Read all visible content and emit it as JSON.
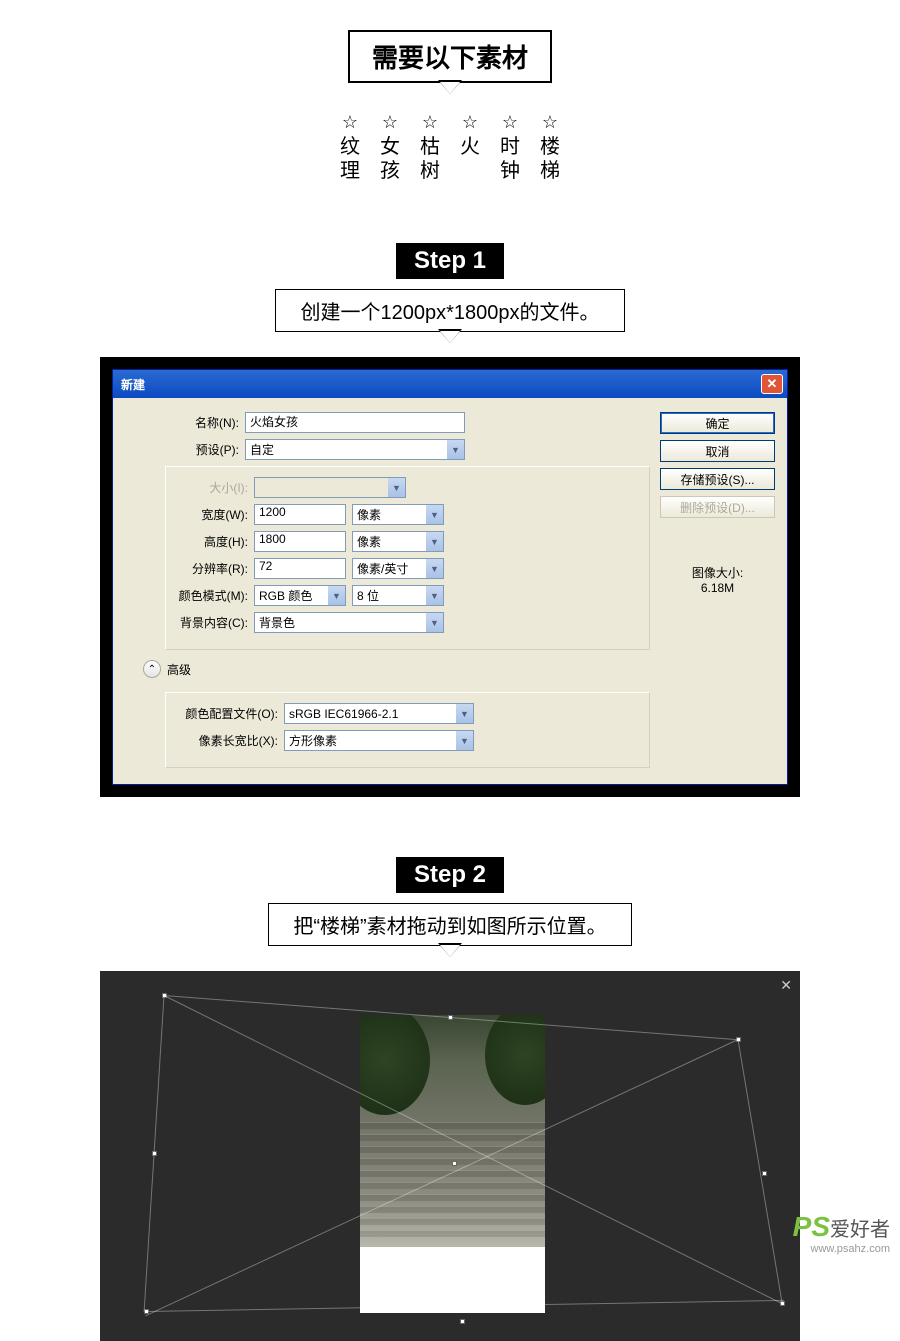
{
  "header": {
    "title": "需要以下素材"
  },
  "materials": [
    {
      "label": "纹理"
    },
    {
      "label": "女孩"
    },
    {
      "label": "枯树"
    },
    {
      "label": "火"
    },
    {
      "label": "时钟"
    },
    {
      "label": "楼梯"
    }
  ],
  "step1": {
    "tag": "Step 1",
    "desc": "创建一个1200px*1800px的文件。",
    "dialog": {
      "title": "新建",
      "name_label": "名称(N):",
      "name_value": "火焰女孩",
      "preset_label": "预设(P):",
      "preset_value": "自定",
      "size_label": "大小(I):",
      "width_label": "宽度(W):",
      "width_value": "1200",
      "width_unit": "像素",
      "height_label": "高度(H):",
      "height_value": "1800",
      "height_unit": "像素",
      "res_label": "分辨率(R):",
      "res_value": "72",
      "res_unit": "像素/英寸",
      "mode_label": "颜色模式(M):",
      "mode_value": "RGB 颜色",
      "mode_bit": "8 位",
      "bg_label": "背景内容(C):",
      "bg_value": "背景色",
      "adv_label": "高级",
      "profile_label": "颜色配置文件(O):",
      "profile_value": "sRGB IEC61966-2.1",
      "aspect_label": "像素长宽比(X):",
      "aspect_value": "方形像素",
      "ok": "确定",
      "cancel": "取消",
      "save_preset": "存储预设(S)...",
      "del_preset": "删除预设(D)...",
      "info_label": "图像大小:",
      "info_value": "6.18M"
    }
  },
  "step2": {
    "tag": "Step 2",
    "desc": "把“楼梯”素材拖动到如图所示位置。"
  },
  "watermark": {
    "ps": "PS",
    "ah": "爱好者",
    "url": "www.psahz.com"
  }
}
